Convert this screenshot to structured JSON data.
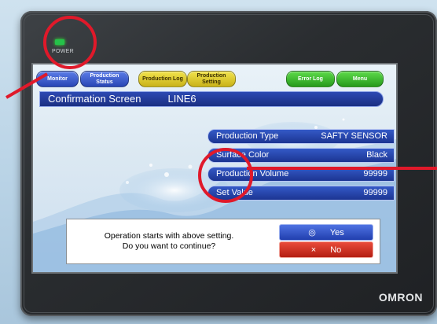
{
  "device": {
    "power_label": "POWER",
    "brand": "OMRON"
  },
  "toolbar": {
    "buttons": [
      {
        "label": "Monitor"
      },
      {
        "label": "Production Status"
      },
      {
        "label": "Production Log"
      },
      {
        "label": "Production Setting"
      },
      {
        "label": "Error Log"
      },
      {
        "label": "Menu"
      }
    ]
  },
  "header": {
    "title": "Confirmation Screen",
    "line": "LINE6"
  },
  "fields": [
    {
      "label": "Production Type",
      "value": "SAFTY SENSOR"
    },
    {
      "label": "Surface Color",
      "value": "Black"
    },
    {
      "label": "Production Volume",
      "value": "99999"
    },
    {
      "label": "Set Value",
      "value": "99999"
    }
  ],
  "dialog": {
    "line1": "Operation starts with above setting.",
    "line2": "Do you want to continue?",
    "yes_icon": "◎",
    "yes_label": "Yes",
    "no_icon": "×",
    "no_label": "No"
  },
  "colors": {
    "highlight_ring": "#e0192a",
    "power_led": "#25c24a"
  }
}
